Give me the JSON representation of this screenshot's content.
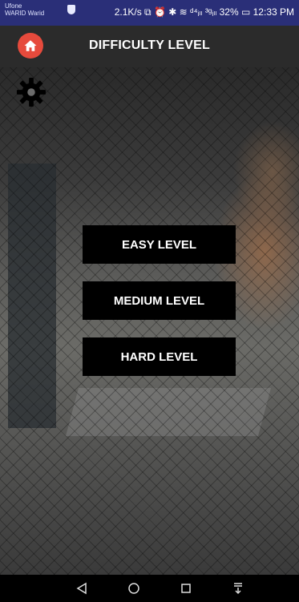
{
  "status_bar": {
    "carrier_line1": "Ufone",
    "carrier_line2": "WARID Warid",
    "indicators": "2.1K/s ⧉ ⏰ ✱ ≋ ᵈ⁴ᵢₗₗ ³ᵍᵢₗₗ 32% ▭ 12:33 PM"
  },
  "header": {
    "title": "DIFFICULTY LEVEL",
    "home_icon": "home-icon",
    "home_color": "#e64a3c"
  },
  "settings": {
    "icon": "gear-icon"
  },
  "levels": {
    "easy": "EASY LEVEL",
    "medium": "MEDIUM LEVEL",
    "hard": "HARD LEVEL"
  },
  "nav": {
    "back_icon": "back-triangle-icon",
    "home_icon": "home-circle-icon",
    "recents_icon": "recents-square-icon",
    "notifications_icon": "notification-pull-icon"
  }
}
